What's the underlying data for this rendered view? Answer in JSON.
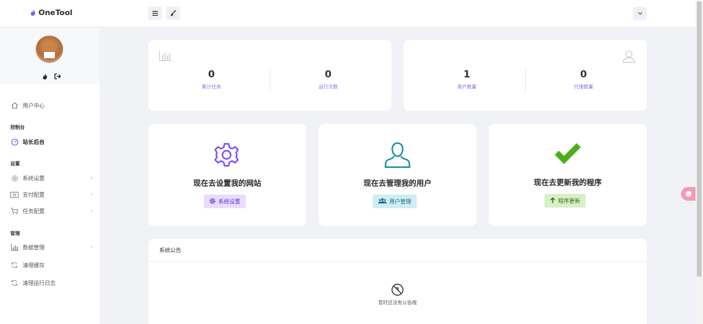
{
  "app": {
    "title": "OneTool"
  },
  "sidebar": {
    "items": [
      {
        "label": "用户中心"
      },
      {
        "label": "站长后台"
      },
      {
        "label": "系统设置"
      },
      {
        "label": "支付配置"
      },
      {
        "label": "任务配置"
      },
      {
        "label": "数据管理"
      },
      {
        "label": "清理缓存"
      },
      {
        "label": "清理运行日志"
      }
    ],
    "sections": {
      "console": "控制台",
      "settings": "设置",
      "manage": "管理"
    }
  },
  "stats": {
    "total_tasks": {
      "value": "0",
      "label": "累计任务"
    },
    "run_count": {
      "value": "0",
      "label": "运行次数"
    },
    "user_count": {
      "value": "1",
      "label": "用户数量"
    },
    "agent_count": {
      "value": "0",
      "label": "代理数量"
    }
  },
  "actions": {
    "settings": {
      "title": "现在去设置我的网站",
      "button": "系统设置",
      "color": "#7c4dff"
    },
    "users": {
      "title": "现在去管理我的用户",
      "button": "用户管理",
      "color": "#1a8fa6"
    },
    "update": {
      "title": "现在去更新我的程序",
      "button": "程序更新",
      "color": "#4caf1a"
    }
  },
  "notice": {
    "title": "系统公告",
    "empty_text": "暂时还没有公告哦"
  },
  "icons": {
    "brand": "flame-icon",
    "menu": "hamburger-menu-icon",
    "brush": "brush-icon",
    "dropdown": "chevron-down-icon"
  }
}
